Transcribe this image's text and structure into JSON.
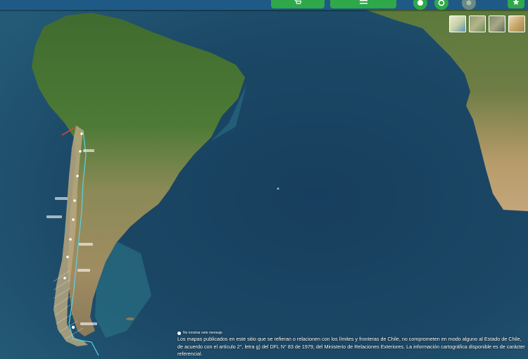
{
  "toolbar": {
    "buttons": [
      {
        "name": "cart-button",
        "icon": "cart-icon"
      },
      {
        "name": "list-button",
        "icon": "list-icon"
      }
    ],
    "round_buttons": [
      {
        "name": "info-button",
        "icon": "info-icon"
      },
      {
        "name": "help-button",
        "icon": "help-icon"
      },
      {
        "name": "layers-button",
        "icon": "layers-icon",
        "state": "inactive"
      },
      {
        "name": "favorites-button",
        "icon": "star-icon"
      }
    ],
    "accent_color": "#2fa84a",
    "bar_color": "#1f5a86"
  },
  "basemaps": [
    "satellite",
    "terrain",
    "relief",
    "topographic"
  ],
  "map": {
    "region": "South America and South Atlantic",
    "highlighted_country": "Chile"
  },
  "disclaimer": {
    "hide_checkbox_label": "No mostrar este mensaje",
    "text": "Los mapas publicados en este sitio que se refieran o relacionen con los límites y fronteras de Chile, no comprometen en modo alguno al Estado de Chile, de acuerdo con el artículo 2°, letra g) del DFL N° 83 de 1979, del Ministerio de Relaciones Exteriores. La información cartográfica disponible es de carácter referencial."
  }
}
